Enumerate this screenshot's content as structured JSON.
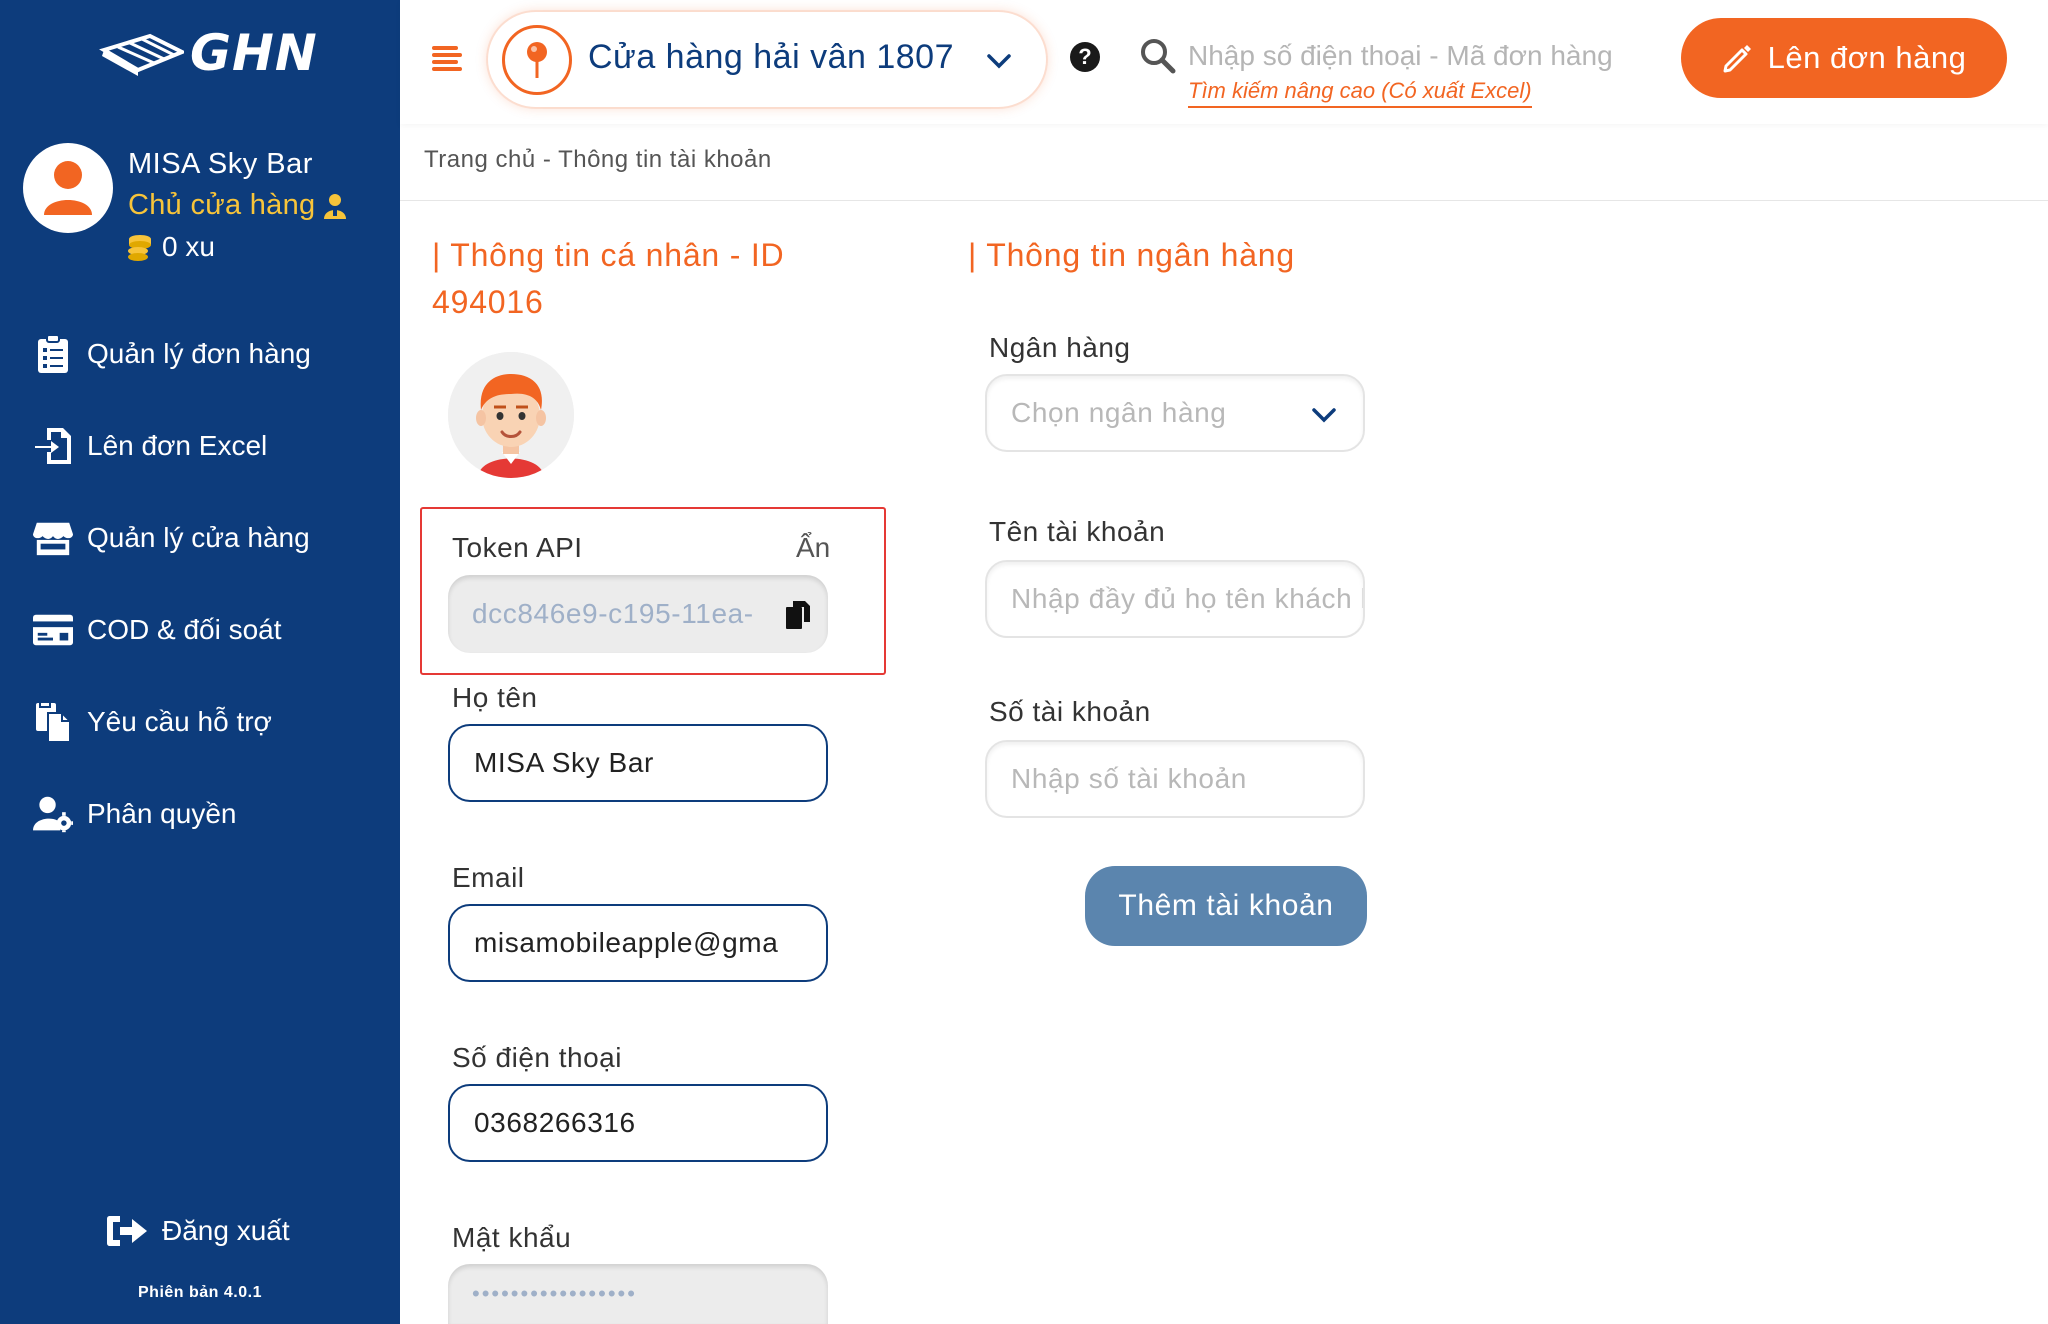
{
  "brand": {
    "logo_text": "GHN"
  },
  "sidebar": {
    "shop_name": "MISA Sky Bar",
    "role": "Chủ cửa hàng",
    "coins": "0 xu",
    "items": [
      {
        "label": "Quản lý đơn hàng",
        "icon": "clipboard-list-icon"
      },
      {
        "label": "Lên đơn Excel",
        "icon": "file-import-icon"
      },
      {
        "label": "Quản lý cửa hàng",
        "icon": "store-icon"
      },
      {
        "label": "COD & đối soát",
        "icon": "credit-card-icon"
      },
      {
        "label": "Yêu cầu hỗ trợ",
        "icon": "copy-files-icon"
      },
      {
        "label": "Phân quyền",
        "icon": "user-gear-icon"
      }
    ],
    "logout": "Đăng xuất",
    "version": "Phiên bản 4.0.1"
  },
  "topbar": {
    "store_name": "Cửa hàng hải vân 1807",
    "search_placeholder": "Nhập số điện thoại - Mã đơn hàng",
    "advanced_search": "Tìm kiếm nâng cao (Có xuất Excel)",
    "create_order": "Lên đơn hàng"
  },
  "breadcrumb": "Trang chủ - Thông tin tài khoản",
  "personal": {
    "title_line1": "| Thông tin cá nhân - ID",
    "title_line2": "494016",
    "token_label": "Token API",
    "token_toggle": "Ẩn",
    "token_value": "dcc846e9-c195-11ea-",
    "name_label": "Họ tên",
    "name_value": "MISA Sky Bar",
    "email_label": "Email",
    "email_value": "misamobileapple@gma",
    "phone_label": "Số điện thoại",
    "phone_value": "0368266316",
    "password_label": "Mật khẩu",
    "password_mask": "•••••••••••••••••"
  },
  "bank": {
    "title": "| Thông tin ngân hàng",
    "bank_label": "Ngân hàng",
    "bank_placeholder": "Chọn ngân hàng",
    "account_name_label": "Tên tài khoản",
    "account_name_placeholder": "Nhập đầy đủ họ tên khách hàng",
    "account_number_label": "Số tài khoản",
    "account_number_placeholder": "Nhập số tài khoản",
    "add_button": "Thêm tài khoản"
  },
  "colors": {
    "sidebar_bg": "#0d3c7c",
    "accent_orange": "#f26522",
    "role_yellow": "#f7c43a",
    "button_blue": "#5b85ae",
    "highlight_red": "#e53935"
  }
}
